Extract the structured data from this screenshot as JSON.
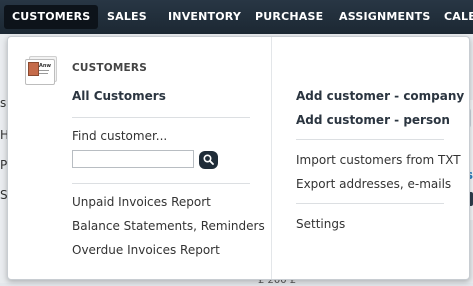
{
  "nav": {
    "items": [
      "CUSTOMERS",
      "SALES",
      "INVENTORY",
      "PURCHASE",
      "ASSIGNMENTS",
      "CALE"
    ],
    "active": "CUSTOMERS"
  },
  "menu": {
    "heading": "CUSTOMERS",
    "icon_text": "Anw",
    "all_customers": "All Customers",
    "find_label": "Find customer...",
    "find_value": "",
    "reports": [
      "Unpaid Invoices Report",
      "Balance Statements, Reminders",
      "Overdue Invoices Report"
    ],
    "add_company": "Add customer - company",
    "add_person": "Add customer - person",
    "import_txt": "Import customers from TXT",
    "export": "Export addresses, e-mails",
    "settings": "Settings"
  },
  "background": {
    "left_letters": [
      "s",
      "H",
      "P",
      "S"
    ],
    "right_mark": "s",
    "price_fragment": "£ 200 £"
  },
  "colors": {
    "nav_bg": "#1f2c38",
    "active_tab": "#0d131a",
    "search_button": "#1f2c38"
  }
}
